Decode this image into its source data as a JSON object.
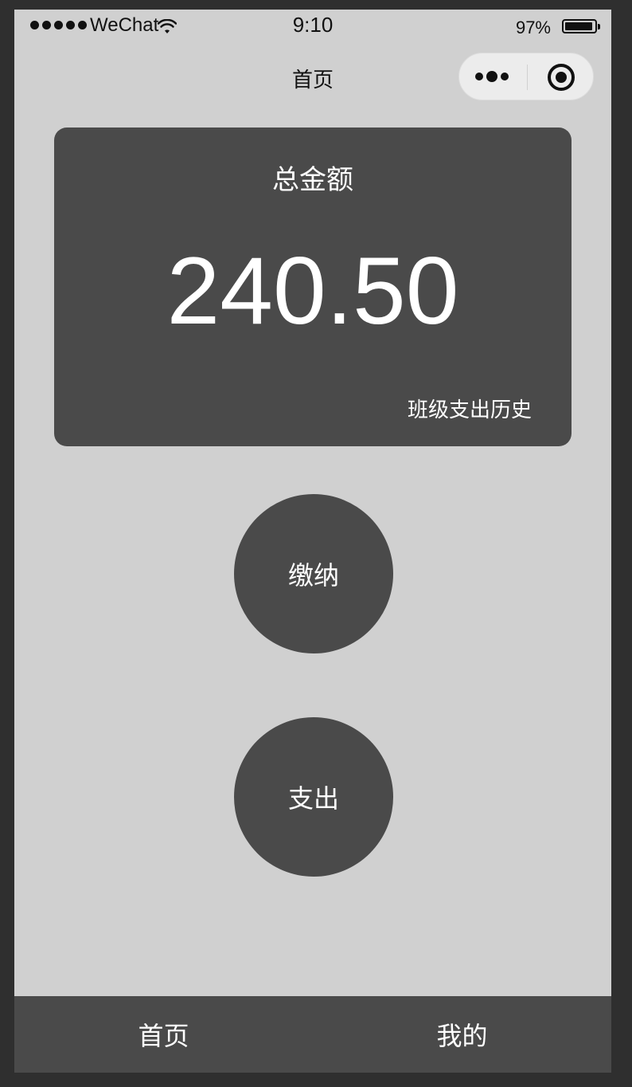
{
  "status_bar": {
    "carrier": "WeChat",
    "time": "9:10",
    "battery_percent": "97%",
    "signal_bars": 5,
    "wifi_icon": "wifi-icon",
    "battery_icon": "battery-icon"
  },
  "nav": {
    "title": "首页",
    "capsule": {
      "more_icon": "more-dots-icon",
      "close_icon": "target-circle-icon"
    }
  },
  "balance_card": {
    "title": "总金额",
    "amount": "240.50",
    "history_link": "班级支出历史"
  },
  "actions": {
    "pay_label": "缴纳",
    "spend_label": "支出"
  },
  "tab_bar": {
    "tabs": [
      {
        "label": "首页"
      },
      {
        "label": "我的"
      }
    ]
  },
  "colors": {
    "background": "#d0d0d0",
    "card": "#4a4a4a",
    "frame": "#2f2f2f",
    "text_light": "#ffffff"
  }
}
